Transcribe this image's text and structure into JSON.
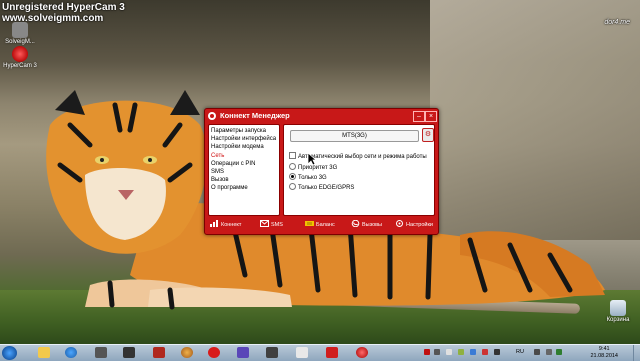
{
  "watermark": {
    "line1": "Unregistered HyperCam 3",
    "line2": "www.solveigmm.com",
    "corner": "dor4.me"
  },
  "desktop_icons": [
    {
      "label": "SolveigM...",
      "icon": "solveigmm-icon"
    },
    {
      "label": "HyperCam 3",
      "icon": "hypercam-icon"
    },
    {
      "label": "Корзина",
      "icon": "recycle-bin-icon"
    }
  ],
  "window": {
    "title": "Коннект Менеджер",
    "minimize": "–",
    "close": "×",
    "nav_items": [
      "Параметры запуска",
      "Настройки интерфейса",
      "Настройки модема",
      "Сеть",
      "Операции с PIN",
      "SMS",
      "Вызов",
      "О программе"
    ],
    "active_nav": "Сеть",
    "network_name": "MTS(3G)",
    "auto_select_label": "Автоматический выбор сети и режима работы",
    "modes": [
      {
        "label": "Приоритет 3G",
        "selected": false
      },
      {
        "label": "Только 3G",
        "selected": true
      },
      {
        "label": "Только EDGE/GPRS",
        "selected": false
      }
    ],
    "toolbar": [
      {
        "label": "Коннект",
        "icon": "signal-bars-icon"
      },
      {
        "label": "SMS",
        "icon": "envelope-icon"
      },
      {
        "label": "Баланс",
        "icon": "coins-icon"
      },
      {
        "label": "Вызовы",
        "icon": "phone-icon"
      },
      {
        "label": "Настройки",
        "icon": "settings-icon"
      }
    ]
  },
  "taskbar": {
    "time": "9:41",
    "date": "21.08.2014",
    "language": "RU"
  },
  "colors": {
    "window_red": "#c81818",
    "nav_active": "#d01010"
  }
}
